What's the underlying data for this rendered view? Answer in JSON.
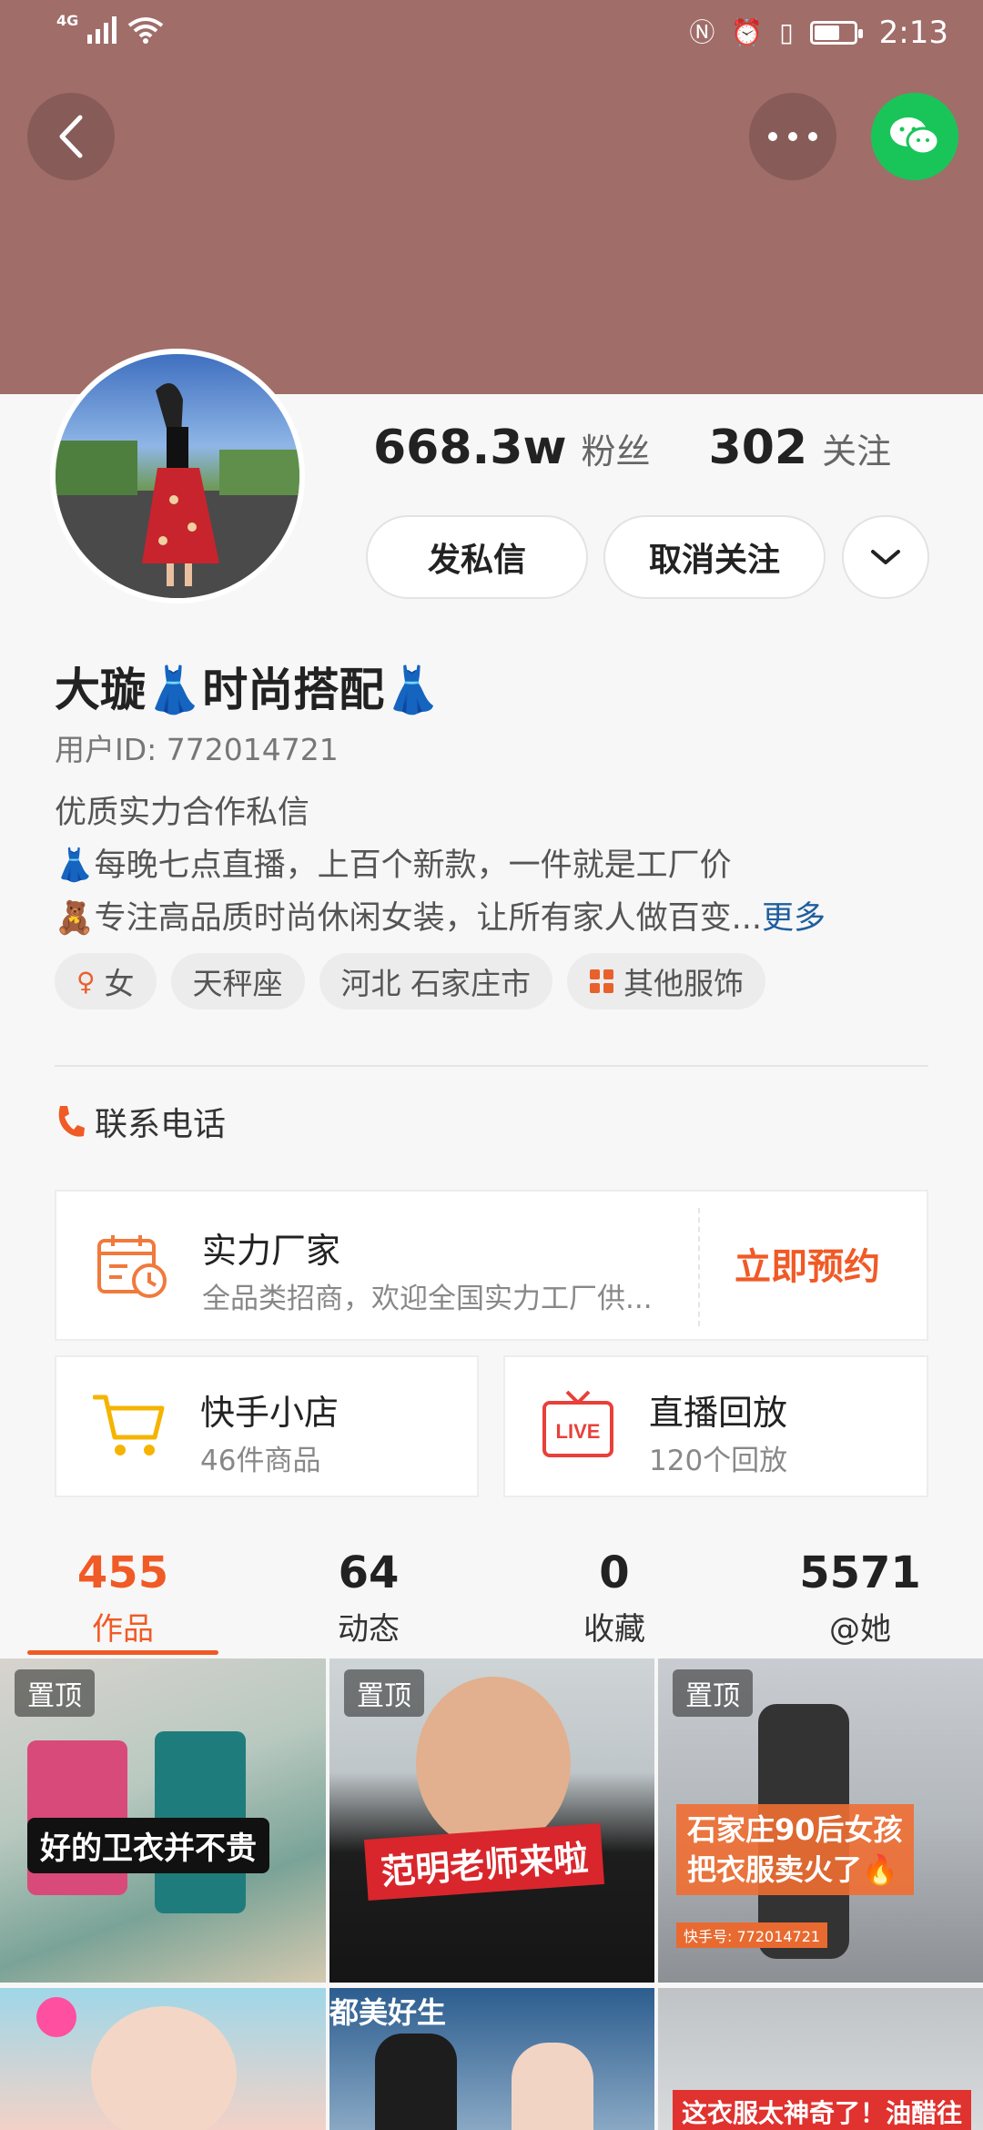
{
  "status_bar": {
    "network": "4G",
    "time": "2:13",
    "battery_level": 0.6,
    "icons": [
      "signal-icon",
      "wifi-icon",
      "nfc-icon",
      "alarm-icon",
      "vibrate-icon",
      "battery-icon"
    ]
  },
  "header": {
    "background_color": "#a06d69",
    "back_icon": "chevron-left-icon",
    "more_icon": "more-dots-icon",
    "share_icon": "wechat-icon"
  },
  "profile": {
    "followers_count": "668.3w",
    "followers_label": "粉丝",
    "following_count": "302",
    "following_label": "关注",
    "dm_label": "发私信",
    "unfollow_label": "取消关注",
    "name": "大璇👗时尚搭配👗",
    "user_id": "用户ID: 772014721",
    "bio_lines": [
      "优质实力合作私信",
      "👗每晚七点直播，上百个新款，一件就是工厂价",
      "🧸专注高品质时尚休闲女装，让所有家人做百变..."
    ],
    "more_link": "更多",
    "tags": [
      {
        "icon": "female-icon",
        "label": "女"
      },
      {
        "icon": "",
        "label": "天秤座"
      },
      {
        "icon": "",
        "label": "河北 石家庄市"
      },
      {
        "icon": "category-icon",
        "label": "其他服饰"
      }
    ]
  },
  "contact": {
    "label": "联系电话",
    "icon": "phone-icon"
  },
  "cards": {
    "factory": {
      "icon": "calendar-clock-icon",
      "title": "实力厂家",
      "subtitle": "全品类招商，欢迎全国实力工厂供...",
      "cta": "立即预约"
    },
    "shop": {
      "icon": "cart-icon",
      "title": "快手小店",
      "subtitle": "46件商品"
    },
    "live": {
      "icon": "live-tv-icon",
      "title": "直播回放",
      "subtitle": "120个回放"
    }
  },
  "tabs": [
    {
      "count": "455",
      "label": "作品",
      "active": true
    },
    {
      "count": "64",
      "label": "动态",
      "active": false
    },
    {
      "count": "0",
      "label": "收藏",
      "active": false
    },
    {
      "count": "5571",
      "label": "@她",
      "active": false
    }
  ],
  "videos": [
    {
      "pinned_label": "置顶",
      "caption": "好的卫衣并不贵"
    },
    {
      "pinned_label": "置顶",
      "caption": "范明老师来啦"
    },
    {
      "pinned_label": "置顶",
      "caption_lines": [
        "石家庄90后女孩",
        "把衣服卖火了🔥"
      ],
      "watermark": "快手号: 772014721"
    },
    {
      "caption": ""
    },
    {
      "caption": "都美好生"
    },
    {
      "caption": "这衣服太神奇了！油醋往"
    }
  ]
}
